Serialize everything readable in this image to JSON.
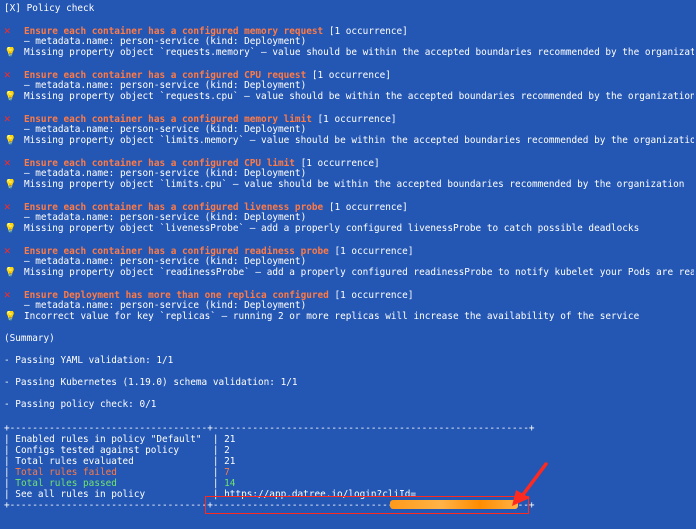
{
  "header": "[X] Policy check",
  "rules": [
    {
      "title": "Ensure each container has a configured memory request",
      "occurrence": "[1 occurrence]",
      "metadata": "— metadata.name: person-service (kind: Deployment)",
      "message": "Missing property object `requests.memory` — value should be within the accepted boundaries recommended by the organization"
    },
    {
      "title": "Ensure each container has a configured CPU request",
      "occurrence": "[1 occurrence]",
      "metadata": "— metadata.name: person-service (kind: Deployment)",
      "message": "Missing property object `requests.cpu` — value should be within the accepted boundaries recommended by the organization"
    },
    {
      "title": "Ensure each container has a configured memory limit",
      "occurrence": "[1 occurrence]",
      "metadata": "— metadata.name: person-service (kind: Deployment)",
      "message": "Missing property object `limits.memory` — value should be within the accepted boundaries recommended by the organization"
    },
    {
      "title": "Ensure each container has a configured CPU limit",
      "occurrence": "[1 occurrence]",
      "metadata": "— metadata.name: person-service (kind: Deployment)",
      "message": "Missing property object `limits.cpu` — value should be within the accepted boundaries recommended by the organization"
    },
    {
      "title": "Ensure each container has a configured liveness probe",
      "occurrence": "[1 occurrence]",
      "metadata": "— metadata.name: person-service (kind: Deployment)",
      "message": "Missing property object `livenessProbe` — add a properly configured livenessProbe to catch possible deadlocks"
    },
    {
      "title": "Ensure each container has a configured readiness probe",
      "occurrence": "[1 occurrence]",
      "metadata": "— metadata.name: person-service (kind: Deployment)",
      "message": "Missing property object `readinessProbe` — add a properly configured readinessProbe to notify kubelet your Pods are ready for traffic"
    },
    {
      "title": "Ensure Deployment has more than one replica configured",
      "occurrence": "[1 occurrence]",
      "metadata": "— metadata.name: person-service (kind: Deployment)",
      "message": "Incorrect value for key `replicas` — running 2 or more replicas will increase the availability of the service"
    }
  ],
  "summary": {
    "heading": "(Summary)",
    "yaml": "- Passing YAML validation: 1/1",
    "k8s": "- Passing Kubernetes (1.19.0) schema validation: 1/1",
    "policy": "- Passing policy check: 0/1"
  },
  "table": {
    "border": "+-----------------------------------+--------------------------------------------------------+",
    "rows": [
      {
        "label": "Enabled rules in policy \"Default\"",
        "value": "21"
      },
      {
        "label": "Configs tested against policy",
        "value": "2"
      },
      {
        "label": "Total rules evaluated",
        "value": "21"
      },
      {
        "label": "Total rules failed",
        "value": "7"
      },
      {
        "label": "Total rules passed",
        "value": "14"
      },
      {
        "label": "See all rules in policy",
        "value": "https://app.datree.io/login?cliId="
      }
    ]
  },
  "icons": {
    "fail": "x-icon",
    "hint": "lightbulb-icon"
  },
  "colors": {
    "background": "#2457b3",
    "rule_title": "#ff7a45",
    "fail_icon": "#ff2a1f",
    "passed": "#6fe36f",
    "highlight_box": "#ff2a1f"
  }
}
